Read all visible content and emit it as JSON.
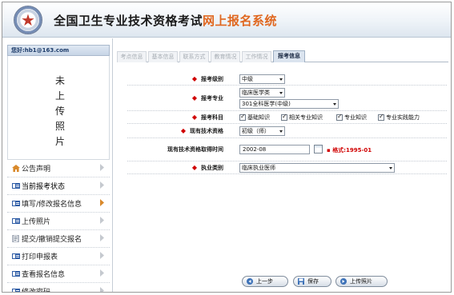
{
  "header": {
    "title_main": "全国卫生专业技术资格考试",
    "title_accent": "网上报名系统"
  },
  "sidebar": {
    "email": "您好:hb1@163.com",
    "photo_text": "未\n上\n传\n照\n片",
    "menu": [
      {
        "label": "公告声明",
        "icon": "home-icon"
      },
      {
        "label": "当前报考状态",
        "icon": "card-icon"
      },
      {
        "label": "填写/修改报名信息",
        "icon": "card-icon"
      },
      {
        "label": "上传照片",
        "icon": "card-icon"
      },
      {
        "label": "提交/撤销提交报名",
        "icon": "document-icon"
      },
      {
        "label": "打印申报表",
        "icon": "card-icon"
      },
      {
        "label": "查看报名信息",
        "icon": "card-icon"
      },
      {
        "label": "修改密码",
        "icon": "card-icon"
      }
    ]
  },
  "tabs": [
    "考点信息",
    "基本信息",
    "联系方式",
    "教育情况",
    "工作情况",
    "报考信息"
  ],
  "active_tab": "报考信息",
  "form": {
    "exam_level": {
      "label": "报考级别",
      "value": "中级"
    },
    "exam_specialty": {
      "label": "报考专业",
      "value1": "临床医学类",
      "value2": "301全科医学(中级)"
    },
    "exam_subjects": {
      "label": "报考科目",
      "options": [
        "基础知识",
        "相关专业知识",
        "专业知识",
        "专业实践能力"
      ]
    },
    "current_qualification": {
      "label": "现有技术资格",
      "value": "初级（师）"
    },
    "qualification_date": {
      "label": "现有技术资格取得时间",
      "value": "2002-08",
      "format_hint": "格式:1995-01"
    },
    "practice_category": {
      "label": "执业类别",
      "value": "临床执业医师"
    }
  },
  "buttons": {
    "prev": "上一步",
    "save": "保存",
    "upload": "上传照片"
  },
  "colors": {
    "accent": "#e0671f",
    "required": "#d00000",
    "tab_active": "#dbe4ef"
  }
}
